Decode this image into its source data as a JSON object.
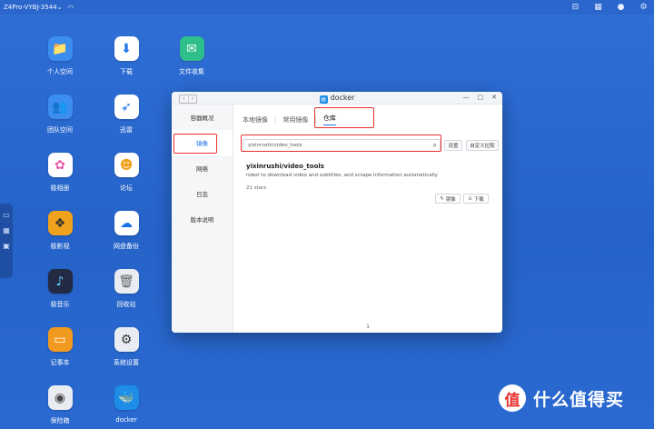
{
  "topbar": {
    "hostname": "Z4Pro-VYBJ-3544",
    "tray_icons": [
      "pin-icon",
      "grid-icon",
      "user-icon",
      "settings-icon"
    ]
  },
  "desktop": {
    "icons": [
      {
        "label": "个人空间",
        "icon": "folder-icon",
        "color": "#3b8ef0"
      },
      {
        "label": "下载",
        "icon": "download-icon",
        "color": "#ffffff"
      },
      {
        "label": "文件收集",
        "icon": "collect-icon",
        "color": "#2fbf8a"
      },
      {
        "label": "团队空间",
        "icon": "team-folder-icon",
        "color": "#3b8ef0"
      },
      {
        "label": "迅雷",
        "icon": "thunder-icon",
        "color": "#ffffff"
      },
      {
        "label": "极相册",
        "icon": "photos-icon",
        "color": "#ffffff"
      },
      {
        "label": "论坛",
        "icon": "forum-icon",
        "color": "#ffffff"
      },
      {
        "label": "极影视",
        "icon": "video-icon",
        "color": "#f0a21c"
      },
      {
        "label": "网盘备份",
        "icon": "cloud-backup-icon",
        "color": "#ffffff"
      },
      {
        "label": "极音乐",
        "icon": "music-icon",
        "color": "#222a44"
      },
      {
        "label": "回收站",
        "icon": "trash-icon",
        "color": "#e9ecf2"
      },
      {
        "label": "记事本",
        "icon": "notepad-icon",
        "color": "#f29a1f"
      },
      {
        "label": "系统设置",
        "icon": "system-settings-icon",
        "color": "#e9ecf2"
      },
      {
        "label": "保险箱",
        "icon": "safe-icon",
        "color": "#e9ecf2"
      },
      {
        "label": "docker",
        "icon": "docker-icon",
        "color": "#1d8de8"
      }
    ]
  },
  "window": {
    "title": "docker",
    "sidebar": [
      "容器概况",
      "镜像",
      "网络",
      "日志",
      "版本说明"
    ],
    "active_sidebar": "镜像",
    "tabs": [
      "本地镜像",
      "常用镜像",
      "仓库"
    ],
    "active_tab": "仓库",
    "search": {
      "value": "yixinrushi/video_tools"
    },
    "buttons": {
      "settings": "设置",
      "custom_pull": "自定义拉取"
    },
    "result": {
      "name": "yixinrushi/video_tools",
      "description": "robot to download video and subtitles, and scrape information automatically",
      "stars": "21 stars",
      "mirror_label": "镜像",
      "download_label": "下载"
    },
    "page": "1"
  },
  "watermark": {
    "logo": "值",
    "text": "什么值得买"
  },
  "colors": {
    "accent": "#1a73e8",
    "highlight": "#e8312f",
    "desktop": "#2563c9"
  }
}
